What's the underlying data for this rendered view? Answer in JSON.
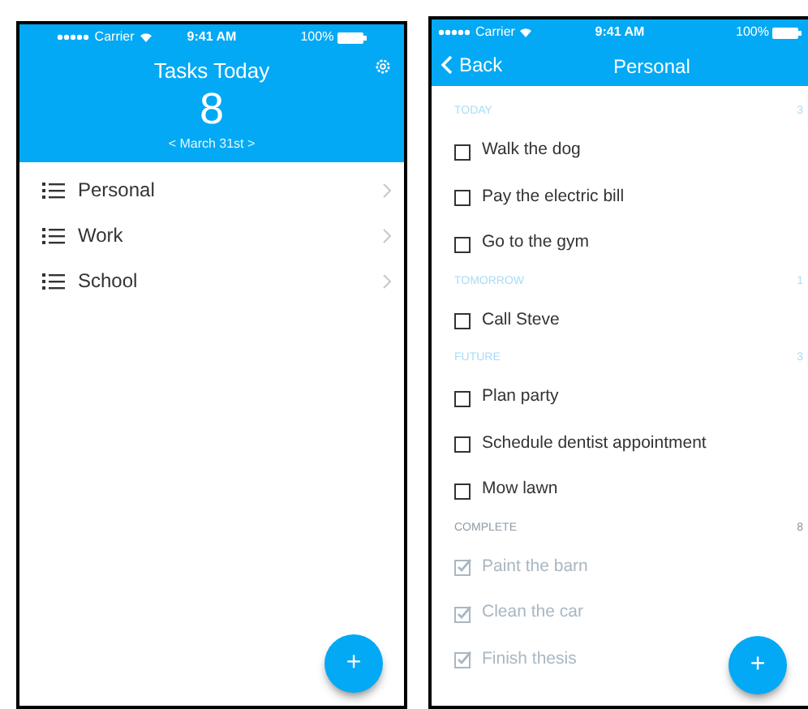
{
  "home": {
    "status_bar": {
      "carrier": "Carrier",
      "time": "9:41 AM",
      "battery": "100%"
    },
    "header": {
      "title": "Tasks Today",
      "count": "8",
      "date": "< March 31st >"
    },
    "lists": [
      {
        "label": "Personal"
      },
      {
        "label": "Work"
      },
      {
        "label": "School"
      }
    ],
    "fab": "+"
  },
  "detail": {
    "status_bar": {
      "carrier": "Carrier",
      "time": "9:41 AM",
      "battery": "100%"
    },
    "nav": {
      "back": "Back",
      "title": "Personal"
    },
    "sections": [
      {
        "title": "TODAY",
        "count": "3",
        "kind": "upcoming",
        "tasks": [
          {
            "label": "Walk the dog",
            "checked": false
          },
          {
            "label": "Pay the electric bill",
            "checked": false
          },
          {
            "label": "Go to the gym",
            "checked": false
          }
        ]
      },
      {
        "title": "TOMORROW",
        "count": "1",
        "kind": "upcoming",
        "tasks": [
          {
            "label": "Call Steve",
            "checked": false
          }
        ]
      },
      {
        "title": "FUTURE",
        "count": "3",
        "kind": "upcoming",
        "tasks": [
          {
            "label": "Plan party",
            "checked": false
          },
          {
            "label": "Schedule dentist appointment",
            "checked": false
          },
          {
            "label": "Mow lawn",
            "checked": false
          }
        ]
      },
      {
        "title": "COMPLETE",
        "count": "8",
        "kind": "complete",
        "tasks": [
          {
            "label": "Paint the barn",
            "checked": true
          },
          {
            "label": "Clean the car",
            "checked": true
          },
          {
            "label": "Finish thesis",
            "checked": true
          }
        ]
      }
    ],
    "fab": "+"
  }
}
